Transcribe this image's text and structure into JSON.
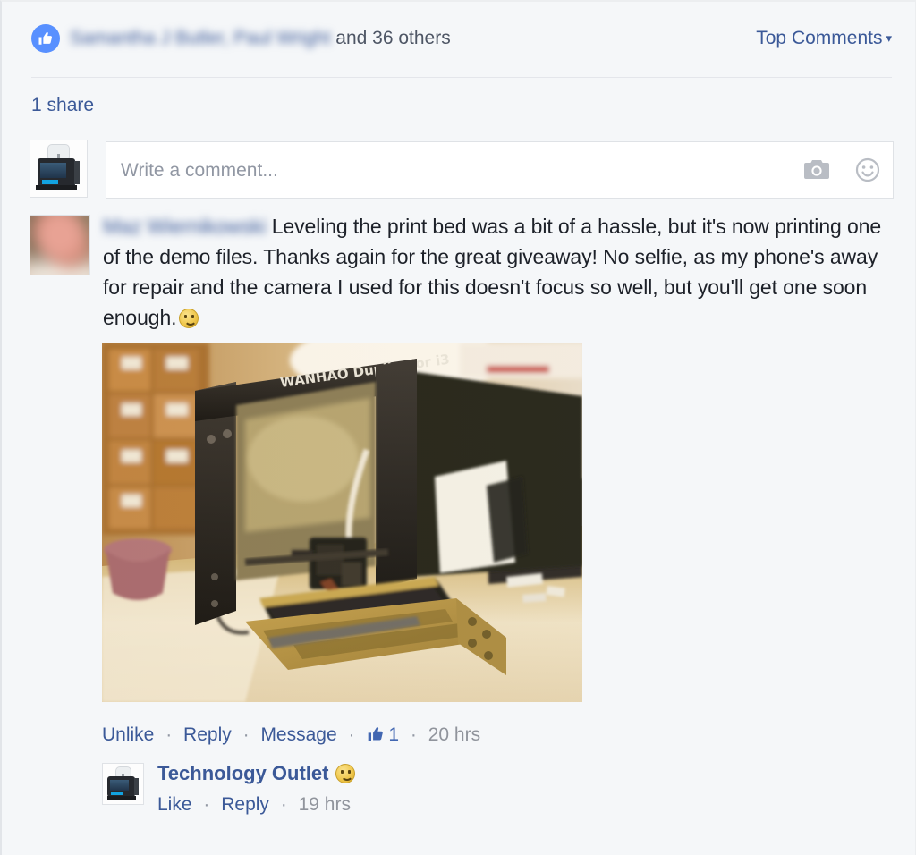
{
  "likes_bar": {
    "thumb_icon": "thumbs-up-icon",
    "names": "Samantha J Butler, Paul Wright",
    "suffix": " and 36 others",
    "sort_label": "Top Comments",
    "sort_caret": "▾"
  },
  "share": {
    "label": "1 share"
  },
  "composer": {
    "avatar_icon": "page-avatar-3d-printer",
    "placeholder": "Write a comment...",
    "value": "",
    "camera_icon": "camera-icon",
    "emoji_icon": "emoji-smiley-icon"
  },
  "comment": {
    "avatar_icon": "user-avatar-photo",
    "author": "Maz Wiernikowski",
    "text": "Leveling the print bed was a bit of a hassle, but it's now printing one of the demo files. Thanks again for the great giveaway! No selfie, as my phone's away for repair and the camera I used for this doesn't focus so well, but you'll get one soon enough.",
    "emoji": "smiley-emoji",
    "photo_alt": "WANHAO Duplicator i3 3D printer on a desk",
    "photo_brand_text": "WANHAO Duplicator i3",
    "actions": {
      "unlike": "Unlike",
      "reply": "Reply",
      "message": "Message",
      "like_count": "1",
      "time": "20 hrs",
      "separator": "·"
    }
  },
  "reply": {
    "avatar_icon": "page-avatar-3d-printer",
    "author": "Technology Outlet",
    "emoji": "smiley-emoji",
    "actions": {
      "like": "Like",
      "reply": "Reply",
      "time": "19 hrs",
      "separator": "·"
    }
  },
  "colors": {
    "link": "#3b5998",
    "facebook_blue": "#5890ff",
    "page_background": "#f5f7f9",
    "text": "#1d2129",
    "muted": "#90949c"
  }
}
